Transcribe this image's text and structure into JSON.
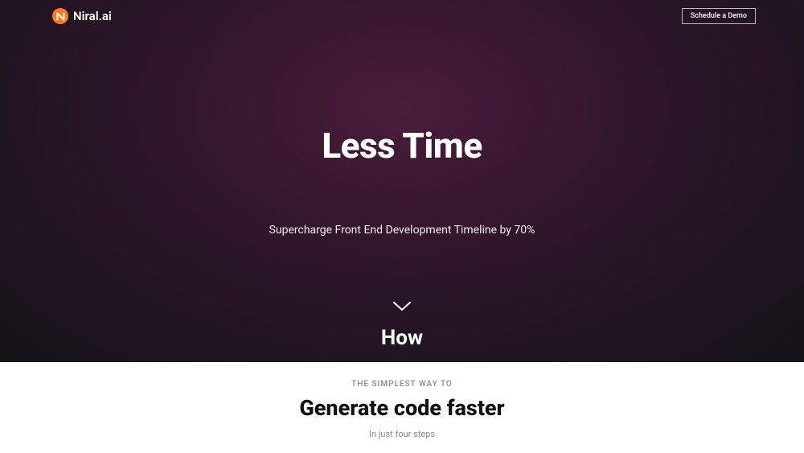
{
  "header": {
    "brand": "Niral.ai",
    "cta": "Schedule a Demo"
  },
  "hero": {
    "title": "Less Time",
    "subtitle": "Supercharge Front End Development Timeline by 70%",
    "how": "How"
  },
  "section2": {
    "eyebrow": "THE SIMPLEST WAY TO",
    "title": "Generate code faster",
    "sub": "In just four steps"
  }
}
